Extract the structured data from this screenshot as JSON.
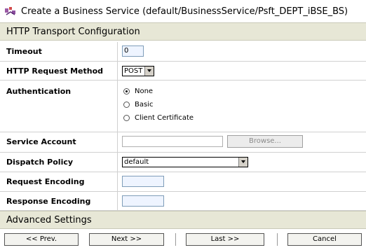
{
  "title": "Create a Business Service (default/BusinessService/Psft_DEPT_iBSE_BS)",
  "section_http": "HTTP Transport Configuration",
  "section_advanced": "Advanced Settings",
  "fields": {
    "timeout": {
      "label": "Timeout",
      "value": "0"
    },
    "method": {
      "label": "HTTP Request Method",
      "value": "POST"
    },
    "auth": {
      "label": "Authentication",
      "options": [
        "None",
        "Basic",
        "Client Certificate"
      ],
      "selected": "None"
    },
    "service_account": {
      "label": "Service Account",
      "value": "",
      "browse": "Browse..."
    },
    "dispatch": {
      "label": "Dispatch Policy",
      "value": "default"
    },
    "req_enc": {
      "label": "Request Encoding",
      "value": ""
    },
    "resp_enc": {
      "label": "Response Encoding",
      "value": ""
    }
  },
  "footer": {
    "prev": "<< Prev.",
    "next": "Next >>",
    "last": "Last >>",
    "cancel": "Cancel"
  }
}
